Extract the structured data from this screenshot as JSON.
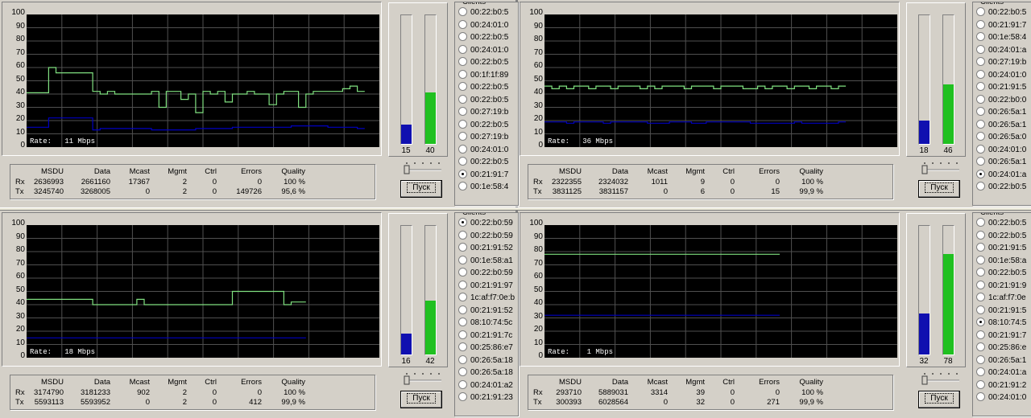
{
  "stats_headers": [
    "MSDU",
    "Data",
    "Mcast",
    "Mgmt",
    "Ctrl",
    "Errors",
    "Quality"
  ],
  "row_labels": [
    "Rx",
    "Tx"
  ],
  "button_label": "Пуск",
  "clients_title": "Clients",
  "y_ticks": [
    "100",
    "90",
    "80",
    "70",
    "60",
    "50",
    "40",
    "30",
    "20",
    "10",
    "0"
  ],
  "colors": {
    "rx_line": "#0000c0",
    "tx_line": "#80e080",
    "bar_blue": "#1010b0",
    "bar_green": "#20c020"
  },
  "panels": [
    {
      "rate": "Rate:   11 Mbps",
      "bar_blue": 15,
      "bar_green": 40,
      "rx": [
        "2636993",
        "2661160",
        "17367",
        "2",
        "0",
        "0",
        "100 %"
      ],
      "tx": [
        "3245740",
        "3268005",
        "0",
        "2",
        "0",
        "149726",
        "95,6 %"
      ],
      "clients": [
        "00:22:b0:5",
        "00:24:01:0",
        "00:22:b0:5",
        "00:24:01:0",
        "00:22:b0:5",
        "00:1f:1f:89",
        "00:22:b0:5",
        "00:22:b0:5",
        "00:27:19:b",
        "00:22:b0:5",
        "00:27:19:b",
        "00:24:01:0",
        "00:22:b0:5",
        "00:21:91:7",
        "00:1e:58:4"
      ],
      "selected": 13
    },
    {
      "rate": "Rate:   36 Mbps",
      "bar_blue": 18,
      "bar_green": 46,
      "rx": [
        "2322355",
        "2324032",
        "1011",
        "9",
        "0",
        "0",
        "100 %"
      ],
      "tx": [
        "3831125",
        "3831157",
        "0",
        "6",
        "0",
        "15",
        "99,9 %"
      ],
      "clients": [
        "00:22:b0:5",
        "00:21:91:7",
        "00:1e:58:4",
        "00:24:01:a",
        "00:27:19:b",
        "00:24:01:0",
        "00:21:91:5",
        "00:22:b0:0",
        "00:26:5a:1",
        "00:26:5a:1",
        "00:26:5a:0",
        "00:24:01:0",
        "00:26:5a:1",
        "00:24:01:a",
        "00:22:b0:5"
      ],
      "selected": 13
    },
    {
      "rate": "Rate:   18 Mbps",
      "bar_blue": 16,
      "bar_green": 42,
      "rx": [
        "3174790",
        "3181233",
        "902",
        "2",
        "0",
        "0",
        "100 %"
      ],
      "tx": [
        "5593113",
        "5593952",
        "0",
        "2",
        "0",
        "412",
        "99,9 %"
      ],
      "clients": [
        "00:22:b0:59",
        "00:22:b0:59",
        "00:21:91:52",
        "00:1e:58:a1",
        "00:22:b0:59",
        "00:21:91:97",
        "1c:af:f7:0e:b",
        "00:21:91:52",
        "08:10:74:5c",
        "00:21:91:7c",
        "00:25:86:e7",
        "00:26:5a:18",
        "00:26:5a:18",
        "00:24:01:a2",
        "00:21:91:23"
      ],
      "selected": 0
    },
    {
      "rate": "Rate:    1 Mbps",
      "bar_blue": 32,
      "bar_green": 78,
      "rx": [
        "293710",
        "5889031",
        "3314",
        "39",
        "0",
        "0",
        "100 %"
      ],
      "tx": [
        "300393",
        "6028564",
        "0",
        "32",
        "0",
        "271",
        "99,9 %"
      ],
      "clients": [
        "00:22:b0:5",
        "00:22:b0:5",
        "00:21:91:5",
        "00:1e:58:a",
        "00:22:b0:5",
        "00:21:91:9",
        "1c:af:f7:0e",
        "00:21:91:5",
        "08:10:74:5",
        "00:21:91:7",
        "00:25:86:e",
        "00:26:5a:1",
        "00:24:01:a",
        "00:21:91:2",
        "00:24:01:0"
      ],
      "selected": 8
    }
  ],
  "chart_data": [
    {
      "type": "line",
      "ylim": [
        0,
        100
      ],
      "xlim": [
        0,
        48
      ],
      "series": [
        {
          "name": "tx",
          "values": [
            41,
            41,
            41,
            60,
            56,
            56,
            56,
            56,
            56,
            42,
            40,
            42,
            40,
            40,
            40,
            40,
            40,
            42,
            30,
            42,
            42,
            36,
            40,
            26,
            42,
            40,
            42,
            34,
            40,
            40,
            42,
            40,
            40,
            32,
            40,
            42,
            42,
            30,
            40,
            42,
            42,
            42,
            42,
            44,
            46,
            42
          ]
        },
        {
          "name": "rx",
          "values": [
            15,
            15,
            15,
            22,
            22,
            22,
            22,
            22,
            22,
            13,
            14,
            14,
            14,
            14,
            14,
            14,
            14,
            13,
            13,
            13,
            13,
            13,
            13,
            14,
            14,
            14,
            14,
            14,
            15,
            15,
            15,
            15,
            15,
            15,
            15,
            15,
            16,
            16,
            16,
            16,
            16,
            15,
            15,
            15,
            15,
            14
          ]
        }
      ]
    },
    {
      "type": "line",
      "ylim": [
        0,
        100
      ],
      "xlim": [
        0,
        48
      ],
      "series": [
        {
          "name": "tx",
          "values": [
            46,
            44,
            46,
            44,
            46,
            46,
            44,
            46,
            46,
            44,
            46,
            46,
            46,
            44,
            46,
            44,
            46,
            46,
            46,
            44,
            46,
            46,
            46,
            44,
            46,
            46,
            46,
            44,
            44,
            46,
            44,
            46,
            46,
            44,
            46,
            46,
            44,
            46,
            46,
            44,
            46
          ]
        },
        {
          "name": "rx",
          "values": [
            19,
            19,
            19,
            18,
            19,
            19,
            19,
            19,
            18,
            19,
            19,
            19,
            19,
            19,
            18,
            18,
            18,
            19,
            19,
            19,
            18,
            18,
            19,
            19,
            19,
            19,
            19,
            19,
            18,
            18,
            18,
            18,
            18,
            18,
            19,
            18,
            18,
            18,
            18,
            18,
            19
          ]
        }
      ]
    },
    {
      "type": "line",
      "ylim": [
        0,
        100
      ],
      "xlim": [
        0,
        48
      ],
      "series": [
        {
          "name": "tx",
          "values": [
            44,
            44,
            44,
            44,
            44,
            44,
            44,
            44,
            44,
            40,
            40,
            40,
            40,
            40,
            40,
            44,
            40,
            40,
            40,
            40,
            40,
            40,
            40,
            40,
            40,
            40,
            40,
            40,
            50,
            50,
            50,
            50,
            50,
            50,
            50,
            40,
            42,
            42
          ]
        },
        {
          "name": "rx",
          "values": [
            15,
            15,
            15,
            15,
            15,
            15,
            15,
            15,
            15,
            15,
            15,
            15,
            15,
            15,
            15,
            15,
            15,
            15,
            15,
            15,
            15,
            15,
            15,
            15,
            15,
            15,
            15,
            15,
            15,
            15,
            15,
            15,
            15,
            15,
            15,
            15,
            15,
            15
          ]
        }
      ]
    },
    {
      "type": "line",
      "ylim": [
        0,
        100
      ],
      "xlim": [
        0,
        48
      ],
      "series": [
        {
          "name": "tx",
          "values": [
            78,
            78,
            78,
            78,
            78,
            78,
            78,
            78,
            78,
            78,
            78,
            78,
            78,
            78,
            78,
            78,
            78,
            78,
            78,
            78,
            78,
            78,
            78,
            78,
            78,
            78,
            78,
            78,
            78,
            78,
            78,
            78
          ]
        },
        {
          "name": "rx",
          "values": [
            32,
            32,
            32,
            32,
            32,
            32,
            32,
            32,
            32,
            32,
            32,
            32,
            32,
            32,
            32,
            32,
            32,
            32,
            32,
            32,
            32,
            32,
            32,
            32,
            32,
            32,
            32,
            32,
            32,
            32,
            32,
            32
          ]
        }
      ]
    }
  ]
}
